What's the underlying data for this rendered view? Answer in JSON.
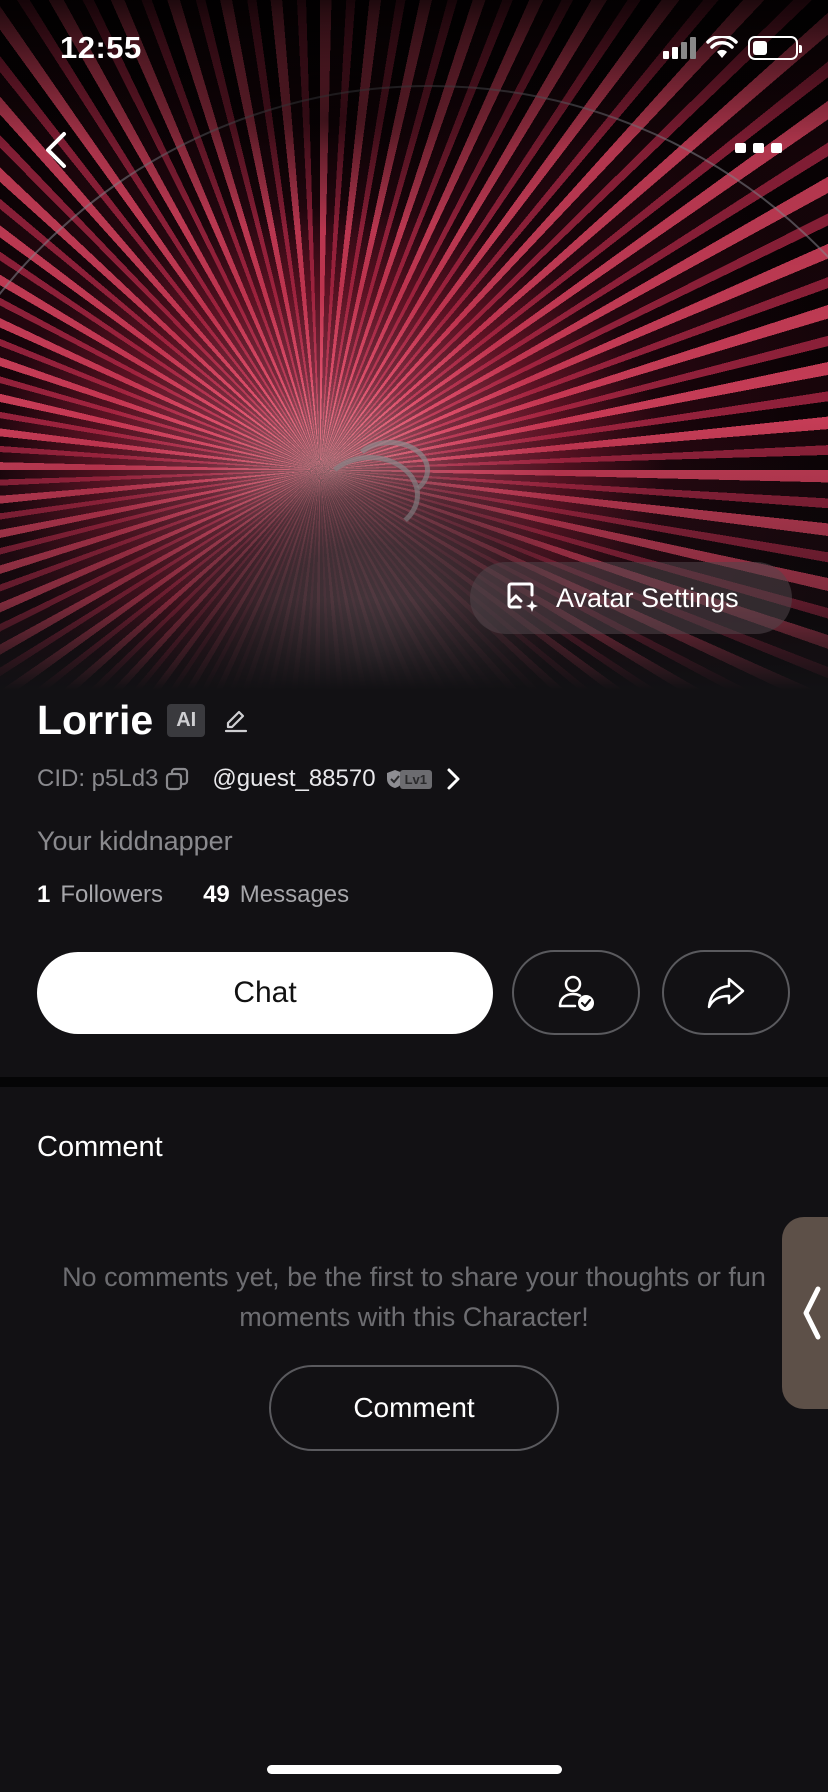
{
  "status_bar": {
    "time": "12:55",
    "battery_level": 0.35
  },
  "profile": {
    "name": "Lorrie",
    "ai_badge": "AI",
    "cid": "CID: p5Ld3",
    "handle": "@guest_88570",
    "level": "Lv1",
    "bio": "Your kiddnapper",
    "followers_count": "1",
    "followers_label": "Followers",
    "messages_count": "49",
    "messages_label": "Messages"
  },
  "hero": {
    "avatar_settings_label": "Avatar Settings"
  },
  "actions": {
    "chat_label": "Chat"
  },
  "comments": {
    "title": "Comment",
    "empty_text": "No comments yet, be the first to share your thoughts or fun moments with this Character!",
    "button_label": "Comment"
  },
  "colors": {
    "background": "#121114",
    "accent_white": "#ffffff",
    "muted_text": "#8a8a8e",
    "side_tab": "#5d5048"
  }
}
